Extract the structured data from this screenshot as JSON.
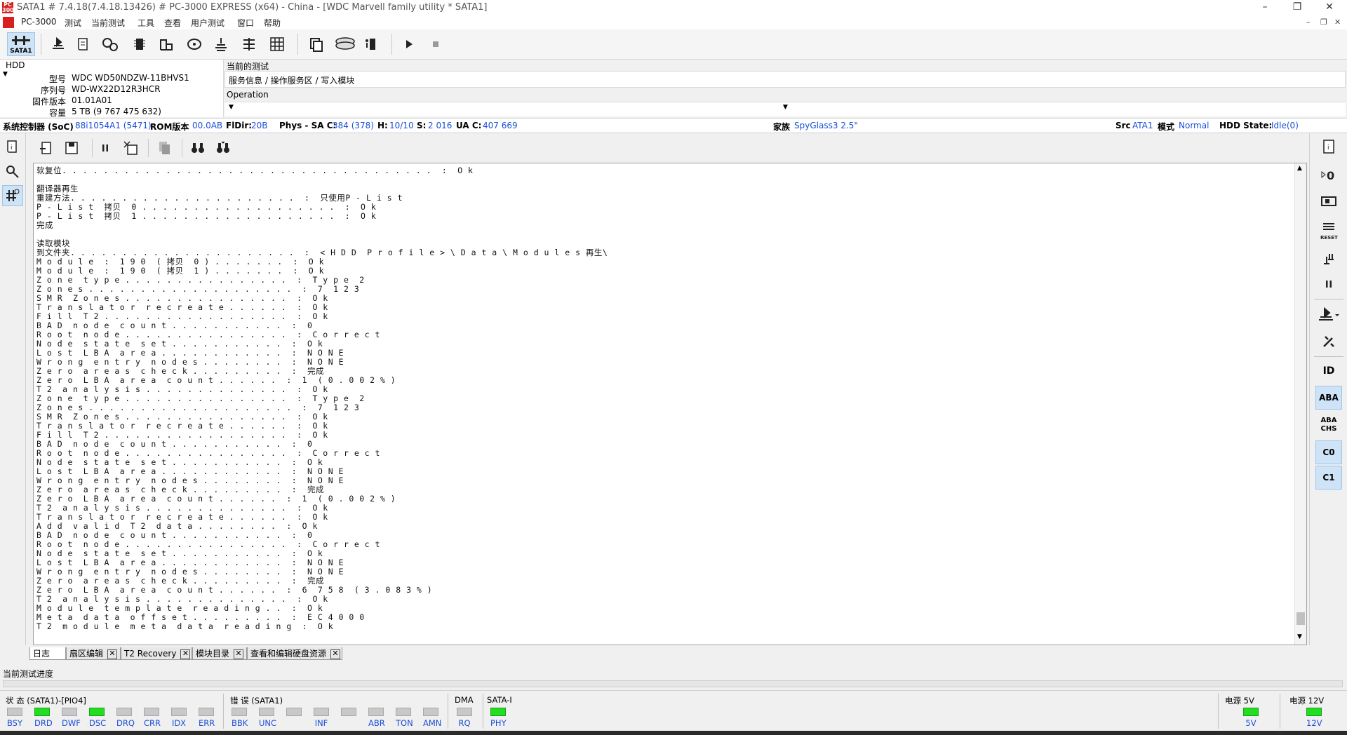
{
  "window": {
    "title": "SATA1 # 7.4.18(7.4.18.13426) # PC-3000 EXPRESS (x64) - China - [WDC Marvell family utility * SATA1]",
    "logo_text": "PC 3000"
  },
  "menu": [
    "PC-3000",
    "测试",
    "当前测试",
    "工具",
    "查看",
    "用户测试",
    "窗口",
    "帮助"
  ],
  "main_toolbar": {
    "sata_label": "SATA1"
  },
  "hdd_panel": {
    "header": "HDD",
    "model_label": "型号",
    "model": "WDC WD50NDZW-11BHVS1",
    "serial_label": "序列号",
    "serial": "WD-WX22D12R3HCR",
    "firmware_label": "固件版本",
    "firmware": "01.01A01",
    "capacity_label": "容量",
    "capacity": "5 TB (9 767 475 632)"
  },
  "current_test": {
    "header": "当前的测试",
    "path": "服务信息 / 操作服务区 / 写入模块",
    "operation_label": "Operation"
  },
  "info_bar": {
    "soc_label": "系统控制器 (SoC)",
    "soc": "88i1054A1 (5471)",
    "rom_label": "ROM版本",
    "rom": "00.0AB",
    "fldir_label": "FlDir:",
    "fldir": "20B",
    "phys_label": "Phys - SA C:",
    "phys_c": "384 (378)",
    "h_label": "H:",
    "h": "10/10",
    "s_label": "S:",
    "s": "2 016",
    "uac_label": "UA C:",
    "uac": "407 669",
    "family_label": "家族",
    "family": "SpyGlass3 2.5\"",
    "src_label": "Src",
    "src": "ATA1",
    "mode_label": "模式",
    "mode": "Normal",
    "state_label": "HDD State:",
    "state": "Idle(0)"
  },
  "log_lines": [
    "软复位. . . . . . . . . . . . . . . . . . . . . . . . . . . . . . . . . . . .  :  O k",
    "",
    "翻译器再生",
    "重建方法. . . . . . . . . . . . . . . . . . . . . .  :  只使用P - L i s t",
    "P - L i s t  拷贝  0 . . . . . . . . . . . . . . . . . . .  :  O k",
    "P - L i s t  拷贝  1 . . . . . . . . . . . . . . . . . . .  :  O k",
    "完成",
    "",
    "读取模块",
    "到文件夹. . . . . . . . . . . . . . . . . . . . . .  :  < H D D  P r o f i l e > \\ D a t a \\ M o d u l e s 再生\\",
    "M o d u l e  :  1 9 0  ( 拷贝  0 ) . . . . . . .  :  O k",
    "M o d u l e  :  1 9 0  ( 拷贝  1 ) . . . . . . .  :  O k",
    "Z o n e  t y p e . . . . . . . . . . . . . . . .  :  T y p e  2",
    "Z o n e s . . . . . . . . . . . . . . . . . . . .  :  7  1 2 3",
    "S M R  Z o n e s . . . . . . . . . . . . . . . .  :  O k",
    "T r a n s l a t o r  r e c r e a t e . . . . . .  :  O k",
    "F i l l  T 2 . . . . . . . . . . . . . . . . . .  :  O k",
    "B A D  n o d e  c o u n t . . . . . . . . . . .  :  0",
    "R o o t  n o d e . . . . . . . . . . . . . . . .  :  C o r r e c t",
    "N o d e  s t a t e  s e t . . . . . . . . . . .  :  O k",
    "L o s t  L B A  a r e a . . . . . . . . . . . .  :  N O N E",
    "W r o n g  e n t r y  n o d e s . . . . . . . .  :  N O N E",
    "Z e r o  a r e a s  c h e c k . . . . . . . . .  :  完成",
    "Z e r o  L B A  a r e a  c o u n t . . . . . .  :  1  ( 0 . 0 0 2 % )",
    "T 2  a n a l y s i s . . . . . . . . . . . . . .  :  O k",
    "Z o n e  t y p e . . . . . . . . . . . . . . . .  :  T y p e  2",
    "Z o n e s . . . . . . . . . . . . . . . . . . . .  :  7  1 2 3",
    "S M R  Z o n e s . . . . . . . . . . . . . . . .  :  O k",
    "T r a n s l a t o r  r e c r e a t e . . . . . .  :  O k",
    "F i l l  T 2 . . . . . . . . . . . . . . . . . .  :  O k",
    "B A D  n o d e  c o u n t . . . . . . . . . . .  :  0",
    "R o o t  n o d e . . . . . . . . . . . . . . . .  :  C o r r e c t",
    "N o d e  s t a t e  s e t . . . . . . . . . . .  :  O k",
    "L o s t  L B A  a r e a . . . . . . . . . . . .  :  N O N E",
    "W r o n g  e n t r y  n o d e s . . . . . . . .  :  N O N E",
    "Z e r o  a r e a s  c h e c k . . . . . . . . .  :  完成",
    "Z e r o  L B A  a r e a  c o u n t . . . . . .  :  1  ( 0 . 0 0 2 % )",
    "T 2  a n a l y s i s . . . . . . . . . . . . . .  :  O k",
    "T r a n s l a t o r  r e c r e a t e . . . . . .  :  O k",
    "A d d  v a l i d  T 2  d a t a . . . . . . . .  :  O k",
    "B A D  n o d e  c o u n t . . . . . . . . . . .  :  0",
    "R o o t  n o d e . . . . . . . . . . . . . . . .  :  C o r r e c t",
    "N o d e  s t a t e  s e t . . . . . . . . . . .  :  O k",
    "L o s t  L B A  a r e a . . . . . . . . . . . .  :  N O N E",
    "W r o n g  e n t r y  n o d e s . . . . . . . .  :  N O N E",
    "Z e r o  a r e a s  c h e c k . . . . . . . . .  :  完成",
    "Z e r o  L B A  a r e a  c o u n t . . . . . .  :  6  7 5 8  ( 3 . 0 8 3 % )",
    "T 2  a n a l y s i s . . . . . . . . . . . . . .  :  O k",
    "M o d u l e  t e m p l a t e  r e a d i n g . .  :  O k",
    "M e t a  d a t a  o f f s e t . . . . . . . . .  :  E C 4 0 0 0",
    "T 2  m o d u l e  m e t a  d a t a  r e a d i n g  :  O k"
  ],
  "tabs": [
    {
      "label": "日志",
      "closable": false
    },
    {
      "label": "扇区编辑",
      "closable": true
    },
    {
      "label": "T2 Recovery",
      "closable": true
    },
    {
      "label": "模块目录",
      "closable": true
    },
    {
      "label": "查看和编辑硬盘资源",
      "closable": true
    }
  ],
  "progress_label": "当前测试进度",
  "status": {
    "state_title": "状 态 (SATA1)-[PIO4]",
    "state_leds": [
      {
        "label": "BSY",
        "on": false
      },
      {
        "label": "DRD",
        "on": true
      },
      {
        "label": "DWF",
        "on": false
      },
      {
        "label": "DSC",
        "on": true
      },
      {
        "label": "DRQ",
        "on": false
      },
      {
        "label": "CRR",
        "on": false
      },
      {
        "label": "IDX",
        "on": false
      },
      {
        "label": "ERR",
        "on": false
      }
    ],
    "error_title": "错 误 (SATA1)",
    "error_leds": [
      {
        "label": "BBK",
        "on": false
      },
      {
        "label": "UNC",
        "on": false
      },
      {
        "label": "",
        "on": false
      },
      {
        "label": "INF",
        "on": false
      },
      {
        "label": "",
        "on": false
      },
      {
        "label": "ABR",
        "on": false
      },
      {
        "label": "TON",
        "on": false
      },
      {
        "label": "AMN",
        "on": false
      }
    ],
    "dma_title": "DMA",
    "dma_led": {
      "label": "RQ",
      "on": false
    },
    "sata_title": "SATA-I",
    "sata_led": {
      "label": "PHY",
      "on": true
    },
    "power5_title": "电源 5V",
    "power5_led": {
      "label": "5V",
      "on": true
    },
    "power12_title": "电源 12V",
    "power12_led": {
      "label": "12V",
      "on": true
    }
  },
  "right_toolbar_labels": [
    "ID",
    "ABA",
    "ABA CHS",
    "C0",
    "C1"
  ],
  "colors": {
    "accent": "#1a4fd8",
    "led_on": "#22dd22",
    "led_off": "#c8c8c8",
    "logo": "#d81e1e"
  }
}
